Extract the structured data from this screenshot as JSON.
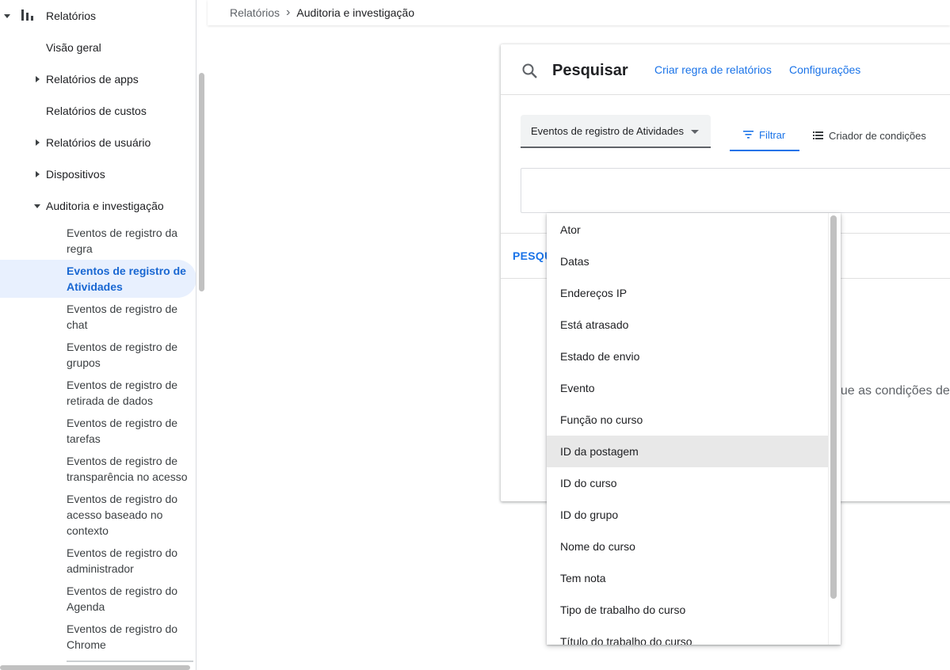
{
  "sidebar": {
    "section_title": "Relatórios",
    "items": [
      {
        "label": "Visão geral"
      },
      {
        "label": "Relatórios de apps"
      },
      {
        "label": "Relatórios de custos"
      },
      {
        "label": "Relatórios de usuário"
      },
      {
        "label": "Dispositivos"
      },
      {
        "label": "Auditoria e investigação"
      }
    ],
    "subitems": [
      "Eventos de registro da regra",
      "Eventos de registro de Atividades",
      "Eventos de registro de chat",
      "Eventos de registro de grupos",
      "Eventos de registro de retirada de dados",
      "Eventos de registro de tarefas",
      "Eventos de registro de transparência no acesso",
      "Eventos de registro do acesso baseado no contexto",
      "Eventos de registro do administrador",
      "Eventos de registro do Agenda",
      "Eventos de registro do Chrome"
    ],
    "active_color": "#1967d2"
  },
  "breadcrumb": {
    "parent": "Relatórios",
    "current": "Auditoria e investigação"
  },
  "card": {
    "title": "Pesquisar",
    "link_create_rule": "Criar regra de relatórios",
    "link_settings": "Configurações",
    "data_source": "Eventos de registro de Atividades",
    "tab_filter": "Filtrar",
    "tab_condition_builder": "Criador de condições",
    "search_button": "PESQU",
    "hint_text": "que as condições de"
  },
  "dropdown": {
    "options": [
      "Ator",
      "Datas",
      "Endereços IP",
      "Está atrasado",
      "Estado de envio",
      "Evento",
      "Função no curso",
      "ID da postagem",
      "ID do curso",
      "ID do grupo",
      "Nome do curso",
      "Tem nota",
      "Tipo de trabalho do curso",
      "Título do trabalho do curso"
    ],
    "highlighted": "ID da postagem"
  },
  "colors": {
    "accent": "#1a73e8",
    "active_bg": "#e8f0fe"
  }
}
